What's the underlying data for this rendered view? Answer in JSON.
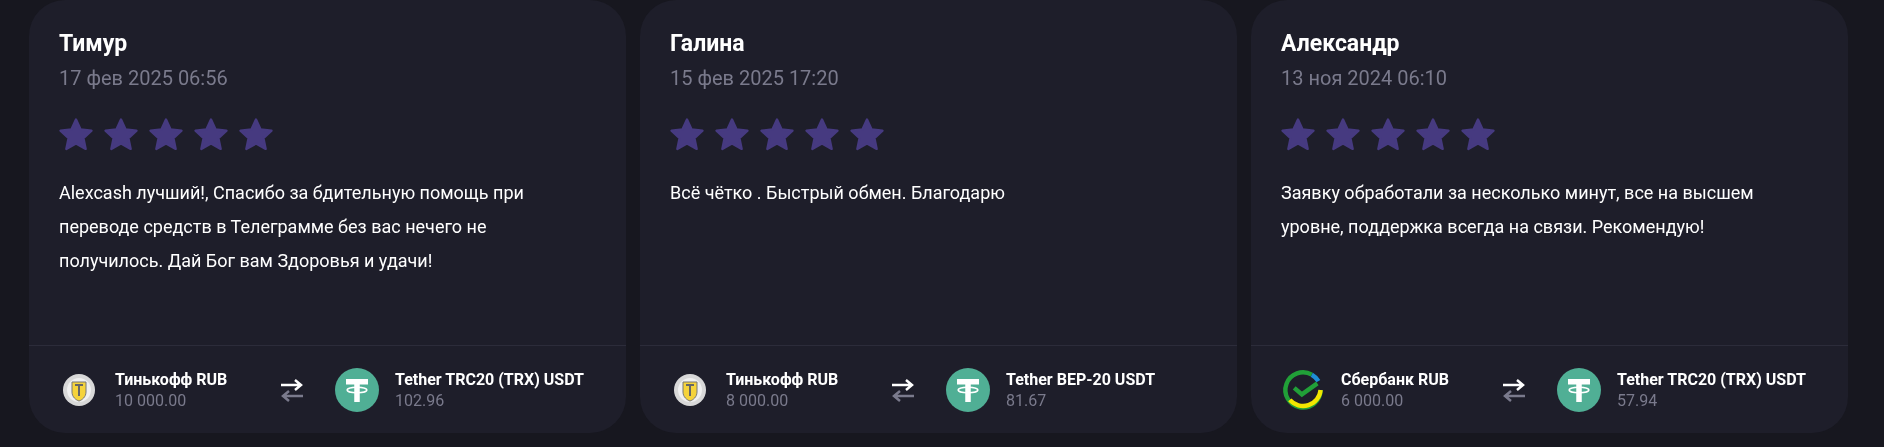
{
  "reviews": [
    {
      "name": "Тимур",
      "date": "17 фев 2025 06:56",
      "stars": 5,
      "text": "Alexcash лучший!, Спасибо за бдительную помощь при переводе средств в Телеграмме без вас нечего не получилось. Дай Бог вам Здоровья и удачи!",
      "from": {
        "kind": "tinkoff",
        "label": "Тинькофф RUB",
        "amount": "10 000.00"
      },
      "to": {
        "kind": "tether",
        "label": "Tether TRC20 (TRX) USDT",
        "amount": "102.96"
      }
    },
    {
      "name": "Галина",
      "date": "15 фев 2025 17:20",
      "stars": 5,
      "text": "Всё чётко . Быстрый обмен. Благодарю",
      "from": {
        "kind": "tinkoff",
        "label": "Тинькофф RUB",
        "amount": "8 000.00"
      },
      "to": {
        "kind": "tether",
        "label": "Tether BEP-20 USDT",
        "amount": "81.67"
      }
    },
    {
      "name": "Александр",
      "date": "13 ноя 2024 06:10",
      "stars": 5,
      "text": "Заявку обработали за несколько минут, все на высшем уровне, поддержка всегда на связи. Рекомендую!",
      "from": {
        "kind": "sber",
        "label": "Сбербанк RUB",
        "amount": "6 000.00"
      },
      "to": {
        "kind": "tether",
        "label": "Tether TRC20 (TRX) USDT",
        "amount": "57.94"
      }
    }
  ]
}
